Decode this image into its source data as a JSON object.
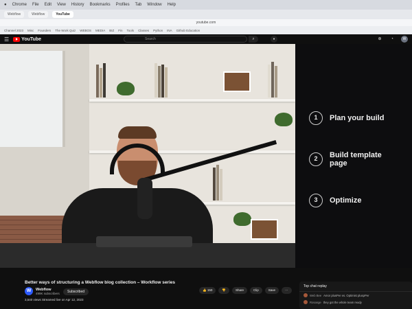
{
  "mac_menu": [
    "Chrome",
    "File",
    "Edit",
    "View",
    "History",
    "Bookmarks",
    "Profiles",
    "Tab",
    "Window",
    "Help"
  ],
  "browser": {
    "tabs": [
      "Webflow",
      "Webflow",
      "YouTube"
    ],
    "address": "youtube.com",
    "bookmarks": [
      "Channel 2023",
      "Misc",
      "Founders",
      "The Work Quiz",
      "WEBOS",
      "MEDIA",
      "BIZ",
      "Fin",
      "Tools",
      "Classes",
      "Python",
      "INA",
      "Github Education"
    ]
  },
  "youtube": {
    "logo_text": "YouTube",
    "search_placeholder": "Search"
  },
  "agenda": [
    {
      "num": "1",
      "text": "Plan your build"
    },
    {
      "num": "2",
      "text": "Build template page"
    },
    {
      "num": "3",
      "text": "Optimize"
    }
  ],
  "video_info": {
    "title": "Better ways of structuring a Webflow blog collection – Workflow series",
    "channel": "Webflow",
    "subscribers": "499K subscribers",
    "subscribe_label": "Subscribed",
    "likes": "150",
    "share": "Share",
    "clip": "Clip",
    "save": "Save",
    "description": "3,540 views  Streamed live on Apr 12, 2023"
  },
  "chat": {
    "header": "Top chat replay",
    "messages": [
      {
        "name": "Web Bee",
        "text": "Amor plusPer es. Optimist pluspPer"
      },
      {
        "name": "Rosange",
        "text": "they got the whole team ready"
      }
    ]
  },
  "colors": {
    "yt_red": "#ff0000",
    "panel_bg": "#0d0d0f",
    "page_bg": "#0f0f0f"
  }
}
